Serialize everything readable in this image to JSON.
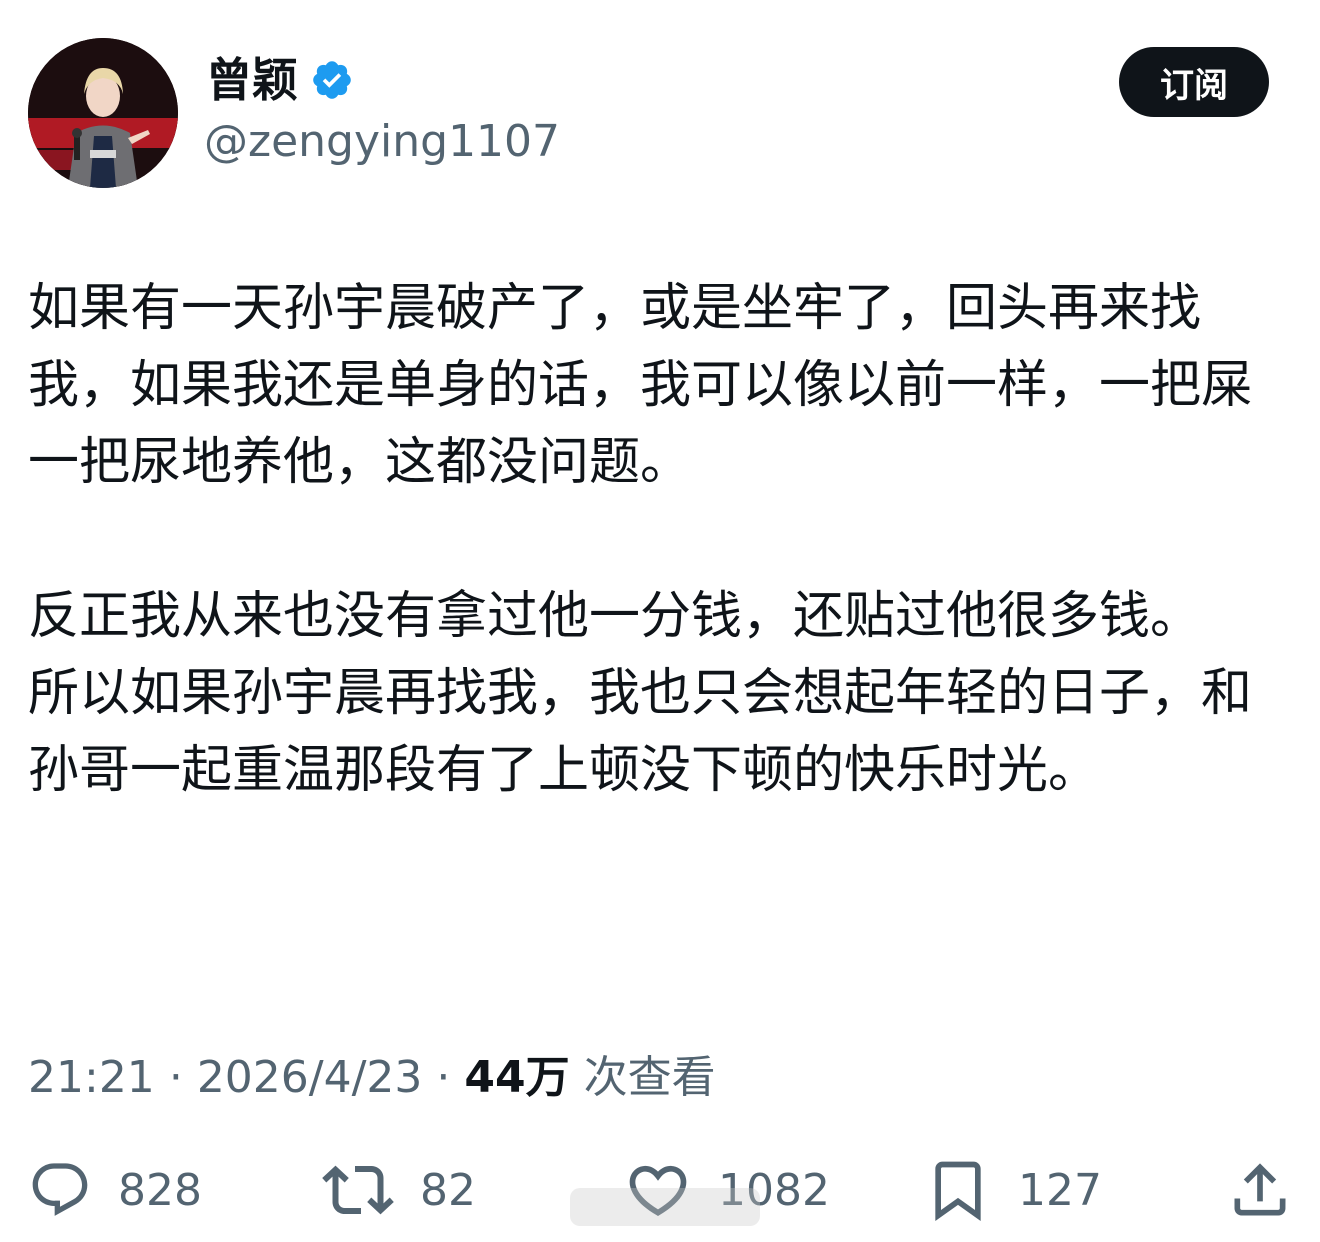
{
  "header": {
    "display_name": "曾颖",
    "handle": "@zengying1107",
    "subscribe_label": "订阅",
    "verified_color": "#1d9bf0"
  },
  "tweet": {
    "paragraph_1": "如果有一天孙宇晨破产了，或是坐牢了，回头再来找我，如果我还是单身的话，我可以像以前一样，一把屎一把尿地养他，这都没问题。",
    "paragraph_2": "反正我从来也没有拿过他一分钱，还贴过他很多钱。",
    "paragraph_3": "所以如果孙宇晨再找我，我也只会想起年轻的日子，和孙哥一起重温那段有了上顿没下顿的快乐时光。"
  },
  "meta": {
    "time": "21:21",
    "separator": "·",
    "date": "2026/4/23",
    "views_count": "44万",
    "views_label": "次查看"
  },
  "actions": {
    "replies": "828",
    "retweets": "82",
    "likes": "1082",
    "bookmarks": "127",
    "icons": [
      "reply-icon",
      "retweet-icon",
      "like-icon",
      "bookmark-icon",
      "share-icon"
    ]
  },
  "colors": {
    "text_primary": "#0f1419",
    "text_secondary": "#536471",
    "button_bg": "#0f1419"
  }
}
